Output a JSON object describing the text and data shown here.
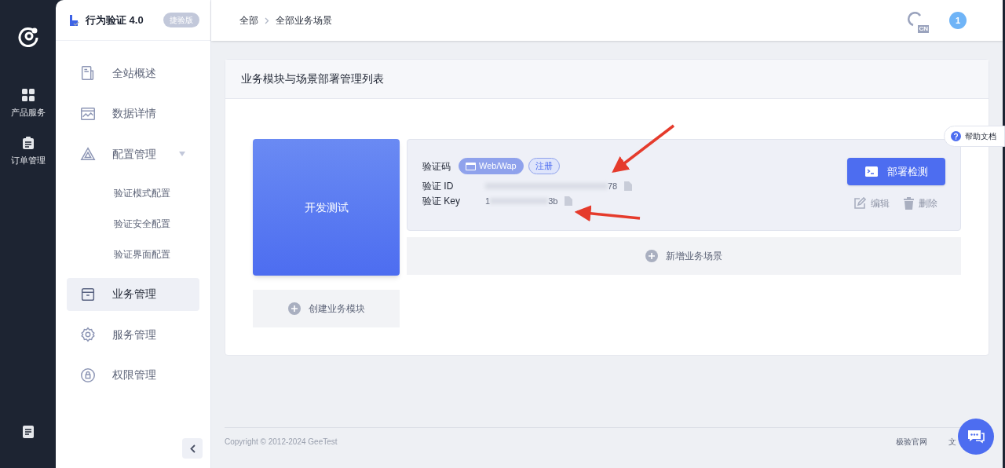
{
  "rail": {
    "items": [
      {
        "kind": "grid",
        "label": "产品服务"
      },
      {
        "kind": "clipboard",
        "label": "订单管理"
      }
    ]
  },
  "sidebar": {
    "title": "行为验证 4.0",
    "badge": "捷验版",
    "items": [
      {
        "kind": "doc",
        "label": "全站概述",
        "selected": false
      },
      {
        "kind": "chart",
        "label": "数据详情",
        "selected": false
      },
      {
        "kind": "triangle",
        "label": "配置管理",
        "selected": false,
        "expanded": true,
        "children": [
          {
            "label": "验证模式配置"
          },
          {
            "label": "验证安全配置"
          },
          {
            "label": "验证界面配置"
          }
        ]
      },
      {
        "kind": "box",
        "label": "业务管理",
        "selected": true
      },
      {
        "kind": "gear",
        "label": "服务管理",
        "selected": false
      },
      {
        "kind": "lock",
        "label": "权限管理",
        "selected": false
      }
    ]
  },
  "breadcrumb": [
    "全部",
    "全部业务场景"
  ],
  "header": {
    "lang": "CN",
    "notifications": "1"
  },
  "panel": {
    "title": "业务模块与场景部署管理列表",
    "module": {
      "name": "开发测试"
    },
    "create_module": "创建业务模块",
    "scene": {
      "label": "验证码",
      "tags": [
        {
          "label": "Web/Wap",
          "selected": true
        },
        {
          "label": "注册",
          "selected": false
        }
      ],
      "id_label": "验证 ID",
      "id_end": "78",
      "key_label": "验证 Key",
      "key_start": "1",
      "key_end": "3b",
      "deploy_button": "部署检测",
      "edit": "编辑",
      "delete": "删除"
    },
    "add_scene": "新增业务场景"
  },
  "help": "帮助文档",
  "footer": {
    "copyright": "Copyright © 2012-2024 GeeTest",
    "links": [
      "极验官网",
      "文"
    ]
  }
}
